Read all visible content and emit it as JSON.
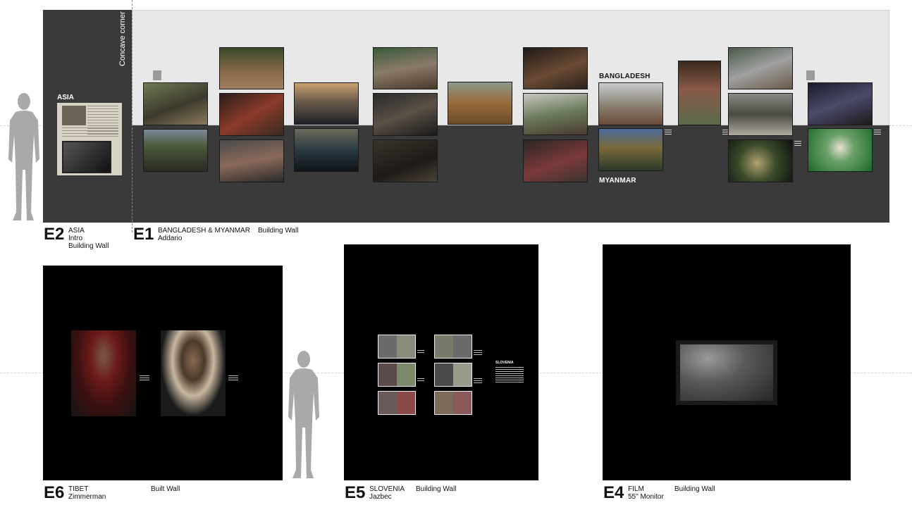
{
  "e1": {
    "corner_label": "Concave corner",
    "asia_heading": "ASIA",
    "bangladesh_label": "BANGLADESH",
    "myanmar_label": "MYANMAR"
  },
  "labels": {
    "e2": {
      "code": "E2",
      "line1": "ASIA",
      "line2": "Intro",
      "line3": "Building Wall"
    },
    "e1": {
      "code": "E1",
      "line1": "BANGLADESH & MYANMAR",
      "line1b": "Building Wall",
      "line2": "Addario"
    },
    "e6": {
      "code": "E6",
      "line1": "TIBET",
      "line1b": "Built Wall",
      "line2": "Zimmerman"
    },
    "e5": {
      "code": "E5",
      "line1": "SLOVENIA",
      "line1b": "Building Wall",
      "line2": "Jazbec"
    },
    "e4": {
      "code": "E4",
      "line1": "FILM",
      "line1b": "Building Wall",
      "line2": "55\" Monitor"
    }
  },
  "e5": {
    "country_heading": "SLOVENIA"
  },
  "colors": {
    "wall_dark": "#3a3a3a",
    "wall_light": "#e8e8e8",
    "exhibit_black": "#000000",
    "silhouette": "#a9a9a9"
  },
  "icons": [
    "person-silhouette-icon",
    "tv-monitor-icon"
  ]
}
